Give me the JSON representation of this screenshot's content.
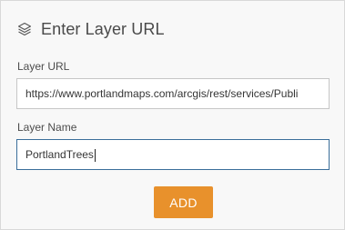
{
  "header": {
    "icon": "layers-icon",
    "title": "Enter Layer URL"
  },
  "layer_url": {
    "label": "Layer URL",
    "value": "https://www.portlandmaps.com/arcgis/rest/services/Publi"
  },
  "layer_name": {
    "label": "Layer Name",
    "value": "PortlandTrees"
  },
  "add_button": {
    "label": "ADD",
    "color": "#e8912c"
  },
  "colors": {
    "panel_background": "#f8f8f8",
    "focused_border": "#3a6e9a"
  }
}
